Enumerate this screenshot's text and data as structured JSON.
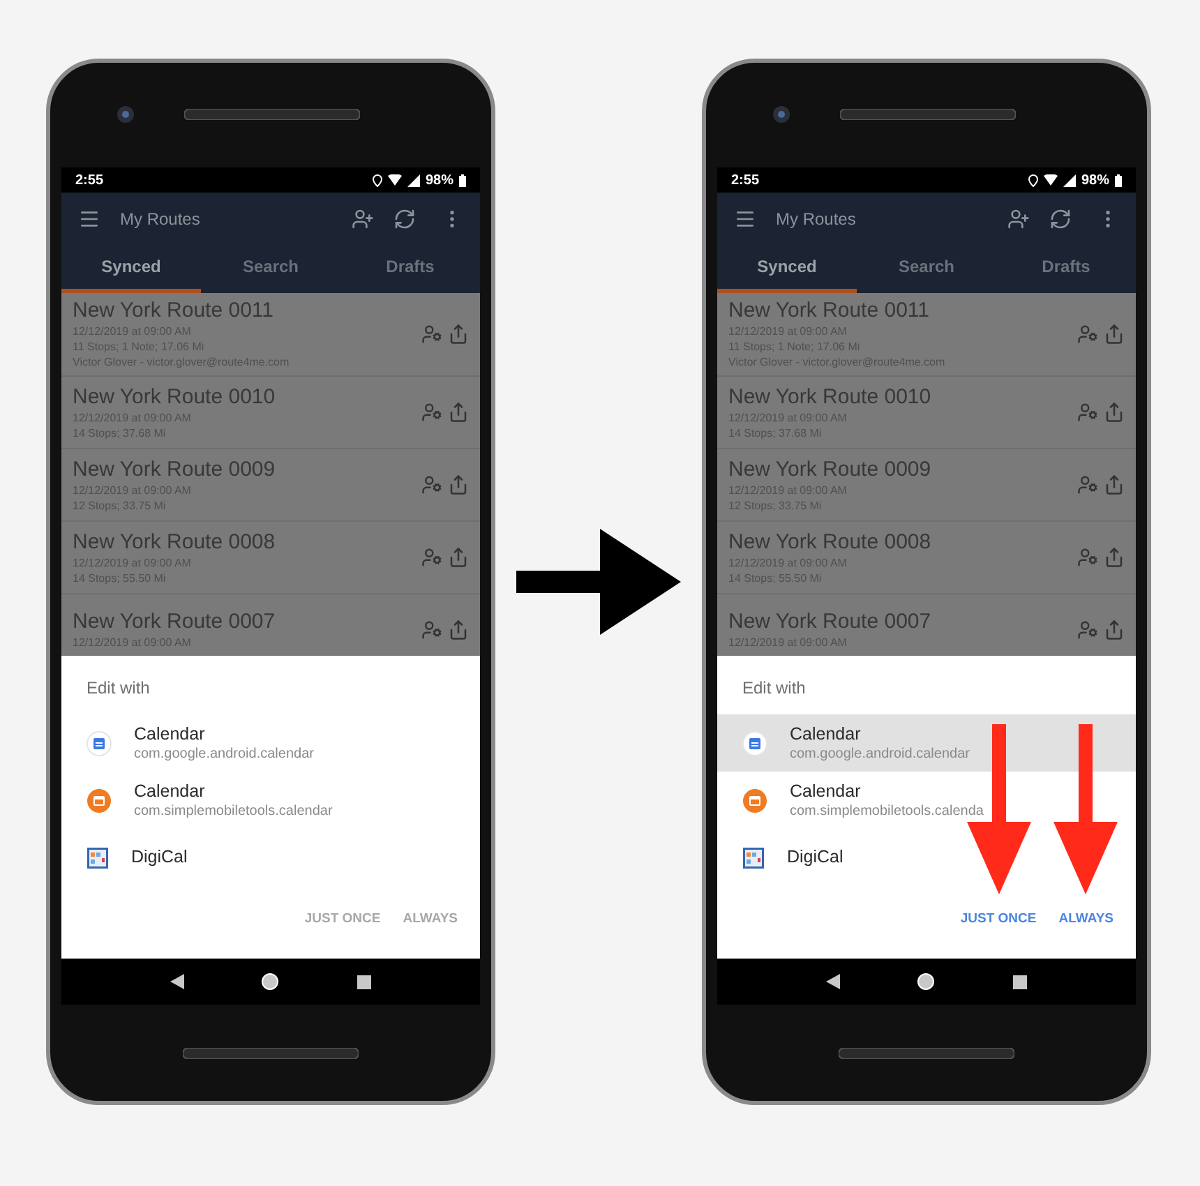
{
  "screens": [
    {
      "status_bar": {
        "time": "2:55",
        "battery": "98%"
      },
      "app_bar": {
        "title": "My Routes"
      },
      "tabs": [
        {
          "label": "Synced",
          "selected": true
        },
        {
          "label": "Search",
          "selected": false
        },
        {
          "label": "Drafts",
          "selected": false
        }
      ],
      "routes": [
        {
          "title": "New York Route 0011",
          "lines": [
            "12/12/2019 at 09:00 AM",
            "11 Stops; 1 Note; 17.06 Mi",
            "Victor Glover - victor.glover@route4me.com"
          ]
        },
        {
          "title": "New York Route 0010",
          "lines": [
            "12/12/2019 at 09:00 AM",
            "14 Stops; 37.68 Mi"
          ]
        },
        {
          "title": "New York Route 0009",
          "lines": [
            "12/12/2019 at 09:00 AM",
            "12 Stops; 33.75 Mi"
          ]
        },
        {
          "title": "New York Route 0008",
          "lines": [
            "12/12/2019 at 09:00 AM",
            "14 Stops; 55.50 Mi"
          ]
        },
        {
          "title": "New York Route 0007",
          "lines": [
            "12/12/2019 at 09:00 AM"
          ]
        }
      ],
      "dialog": {
        "title": "Edit with",
        "apps": [
          {
            "kind": "google",
            "name": "Calendar",
            "package": "com.google.android.calendar",
            "selected": false
          },
          {
            "kind": "simple",
            "name": "Calendar",
            "package": "com.simplemobiletools.calendar",
            "selected": false
          },
          {
            "kind": "digical",
            "name": "DigiCal",
            "selected": false
          }
        ],
        "buttons": [
          {
            "label": "JUST ONCE",
            "enabled": false,
            "arrow": false
          },
          {
            "label": "ALWAYS",
            "enabled": false,
            "arrow": false
          }
        ]
      }
    },
    {
      "status_bar": {
        "time": "2:55",
        "battery": "98%"
      },
      "app_bar": {
        "title": "My Routes"
      },
      "tabs": [
        {
          "label": "Synced",
          "selected": true
        },
        {
          "label": "Search",
          "selected": false
        },
        {
          "label": "Drafts",
          "selected": false
        }
      ],
      "routes": [
        {
          "title": "New York Route 0011",
          "lines": [
            "12/12/2019 at 09:00 AM",
            "11 Stops; 1 Note; 17.06 Mi",
            "Victor Glover - victor.glover@route4me.com"
          ]
        },
        {
          "title": "New York Route 0010",
          "lines": [
            "12/12/2019 at 09:00 AM",
            "14 Stops; 37.68 Mi"
          ]
        },
        {
          "title": "New York Route 0009",
          "lines": [
            "12/12/2019 at 09:00 AM",
            "12 Stops; 33.75 Mi"
          ]
        },
        {
          "title": "New York Route 0008",
          "lines": [
            "12/12/2019 at 09:00 AM",
            "14 Stops; 55.50 Mi"
          ]
        },
        {
          "title": "New York Route 0007",
          "lines": [
            "12/12/2019 at 09:00 AM"
          ]
        }
      ],
      "dialog": {
        "title": "Edit with",
        "apps": [
          {
            "kind": "google",
            "name": "Calendar",
            "package": "com.google.android.calendar",
            "selected": true
          },
          {
            "kind": "simple",
            "name": "Calendar",
            "package": "com.simplemobiletools.calenda",
            "selected": false
          },
          {
            "kind": "digical",
            "name": "DigiCal",
            "selected": false
          }
        ],
        "buttons": [
          {
            "label": "JUST ONCE",
            "enabled": true,
            "arrow": true
          },
          {
            "label": "ALWAYS",
            "enabled": true,
            "arrow": true
          }
        ]
      }
    }
  ]
}
